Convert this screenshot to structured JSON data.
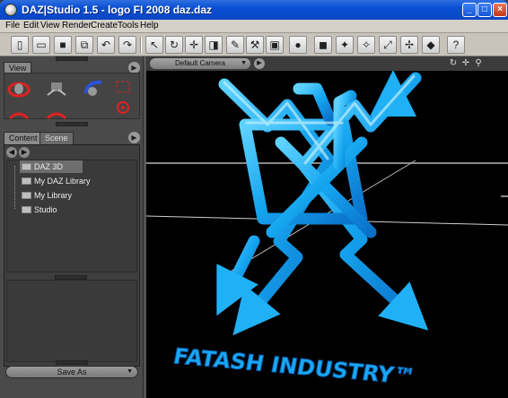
{
  "window": {
    "title": "DAZ|Studio 1.5 - logo FI 2008 daz.daz"
  },
  "menu": [
    "File",
    "Edit",
    "View",
    "Render",
    "Create",
    "Tools",
    "Help"
  ],
  "toolbar": {
    "icons": [
      "new-icon",
      "open-icon",
      "save-icon",
      "import-icon",
      "undo-icon",
      "redo-icon",
      "select-icon",
      "rotate-icon",
      "translate-icon",
      "scale-icon",
      "light-icon",
      "camera-icon",
      "render-icon",
      "sphere-icon",
      "add-node-icon",
      "spotlight-icon",
      "pointlight-icon",
      "distantlight-icon",
      "camera-add-icon",
      "help-icon"
    ]
  },
  "view_panel": {
    "tab": "View"
  },
  "content_panel": {
    "tabs": [
      "Content",
      "Scene"
    ],
    "tree": [
      "DAZ 3D",
      "My DAZ Library",
      "My Library",
      "Studio"
    ]
  },
  "save_as": "Save As",
  "viewport": {
    "camera": "Default Camera",
    "logo_text": "FATASH INDUSTRY™"
  },
  "colors": {
    "logo": "#1aa8f2",
    "titlebar": "#0b4fd4",
    "panel": "#4a4a4a"
  }
}
